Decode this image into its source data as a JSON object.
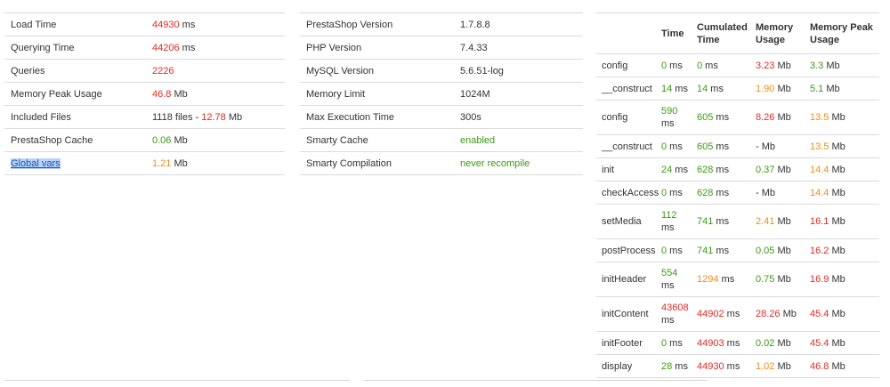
{
  "summary": [
    {
      "label": "Load Time",
      "parts": [
        {
          "text": "44930",
          "tone": "red"
        },
        {
          "text": " ms",
          "tone": "plain"
        }
      ]
    },
    {
      "label": "Querying Time",
      "parts": [
        {
          "text": "44206",
          "tone": "red"
        },
        {
          "text": " ms",
          "tone": "plain"
        }
      ]
    },
    {
      "label": "Queries",
      "parts": [
        {
          "text": "2226",
          "tone": "red"
        }
      ]
    },
    {
      "label": "Memory Peak Usage",
      "parts": [
        {
          "text": "46.8",
          "tone": "red"
        },
        {
          "text": " Mb",
          "tone": "plain"
        }
      ]
    },
    {
      "label": "Included Files",
      "parts": [
        {
          "text": "1118 files - ",
          "tone": "plain"
        },
        {
          "text": "12.78",
          "tone": "red"
        },
        {
          "text": " Mb",
          "tone": "plain"
        }
      ]
    },
    {
      "label": "PrestaShop Cache",
      "parts": [
        {
          "text": "0.06",
          "tone": "green"
        },
        {
          "text": " Mb",
          "tone": "plain"
        }
      ]
    },
    {
      "label": "Global vars",
      "selected": true,
      "parts": [
        {
          "text": "1.21",
          "tone": "orange"
        },
        {
          "text": " Mb",
          "tone": "plain"
        }
      ]
    }
  ],
  "config": [
    {
      "label": "PrestaShop Version",
      "value": "1.7.8.8",
      "tone": "plain"
    },
    {
      "label": "PHP Version",
      "value": "7.4.33",
      "tone": "plain"
    },
    {
      "label": "MySQL Version",
      "value": "5.6.51-log",
      "tone": "plain"
    },
    {
      "label": "Memory Limit",
      "value": "1024M",
      "tone": "plain"
    },
    {
      "label": "Max Execution Time",
      "value": "300s",
      "tone": "plain"
    },
    {
      "label": "Smarty Cache",
      "value": "enabled",
      "tone": "green"
    },
    {
      "label": "Smarty Compilation",
      "value": "never recompile",
      "tone": "green"
    }
  ],
  "profiler": {
    "headers": [
      "",
      "Time",
      "Cumulated Time",
      "Memory Usage",
      "Memory Peak Usage"
    ],
    "rows": [
      {
        "step": "config",
        "time": "0",
        "time_tone": "green",
        "cum": "0",
        "cum_tone": "green",
        "mem": "3.23",
        "mem_tone": "red",
        "peak": "3.3",
        "peak_tone": "green"
      },
      {
        "step": "__construct",
        "time": "14",
        "time_tone": "green",
        "cum": "14",
        "cum_tone": "green",
        "mem": "1.90",
        "mem_tone": "orange",
        "peak": "5.1",
        "peak_tone": "green"
      },
      {
        "step": "config",
        "tall": true,
        "time": "590",
        "time_tone": "green",
        "cum": "605",
        "cum_tone": "green",
        "mem": "8.26",
        "mem_tone": "red",
        "peak": "13.5",
        "peak_tone": "orange"
      },
      {
        "step": "__construct",
        "time": "0",
        "time_tone": "green",
        "cum": "605",
        "cum_tone": "green",
        "mem": "-",
        "mem_tone": "plain",
        "peak": "13.5",
        "peak_tone": "orange"
      },
      {
        "step": "init",
        "time": "24",
        "time_tone": "green",
        "cum": "628",
        "cum_tone": "green",
        "mem": "0.37",
        "mem_tone": "green",
        "peak": "14.4",
        "peak_tone": "orange"
      },
      {
        "step": "checkAccess",
        "time": "0",
        "time_tone": "green",
        "cum": "628",
        "cum_tone": "green",
        "mem": "-",
        "mem_tone": "plain",
        "peak": "14.4",
        "peak_tone": "orange"
      },
      {
        "step": "setMedia",
        "tall": true,
        "time": "112",
        "time_tone": "green",
        "cum": "741",
        "cum_tone": "green",
        "mem": "2.41",
        "mem_tone": "orange",
        "peak": "16.1",
        "peak_tone": "red"
      },
      {
        "step": "postProcess",
        "time": "0",
        "time_tone": "green",
        "cum": "741",
        "cum_tone": "green",
        "mem": "0.05",
        "mem_tone": "green",
        "peak": "16.2",
        "peak_tone": "red"
      },
      {
        "step": "initHeader",
        "tall": true,
        "time": "554",
        "time_tone": "green",
        "cum": "1294",
        "cum_tone": "orange",
        "mem": "0.75",
        "mem_tone": "green",
        "peak": "16.9",
        "peak_tone": "red"
      },
      {
        "step": "initContent",
        "tall": true,
        "time": "43608",
        "time_tone": "red",
        "cum": "44902",
        "cum_tone": "red",
        "mem": "28.26",
        "mem_tone": "red",
        "peak": "45.4",
        "peak_tone": "red"
      },
      {
        "step": "initFooter",
        "time": "0",
        "time_tone": "green",
        "cum": "44903",
        "cum_tone": "red",
        "mem": "0.02",
        "mem_tone": "green",
        "peak": "45.4",
        "peak_tone": "red"
      },
      {
        "step": "display",
        "time": "28",
        "time_tone": "green",
        "cum": "44930",
        "cum_tone": "red",
        "mem": "1.02",
        "mem_tone": "orange",
        "peak": "46.8",
        "peak_tone": "red"
      }
    ],
    "units": {
      "time": " ms",
      "memory": " Mb"
    }
  },
  "colors": {
    "red": "#e52a24",
    "orange": "#ef8d1d",
    "green": "#3a9b13",
    "selection": "#b8d4fb"
  }
}
